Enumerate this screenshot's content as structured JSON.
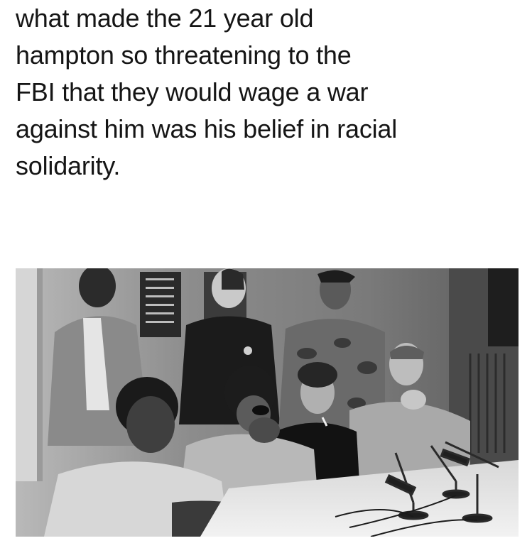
{
  "caption": {
    "lines": [
      "what made the 21 year old",
      "hampton so threatening to the",
      "FBI that they would wage a war",
      "against him was his belief in racial",
      "solidarity."
    ]
  },
  "photo": {
    "kind": "black-and-white photograph",
    "colors": {
      "background": "#ffffff",
      "text": "#151515"
    }
  }
}
